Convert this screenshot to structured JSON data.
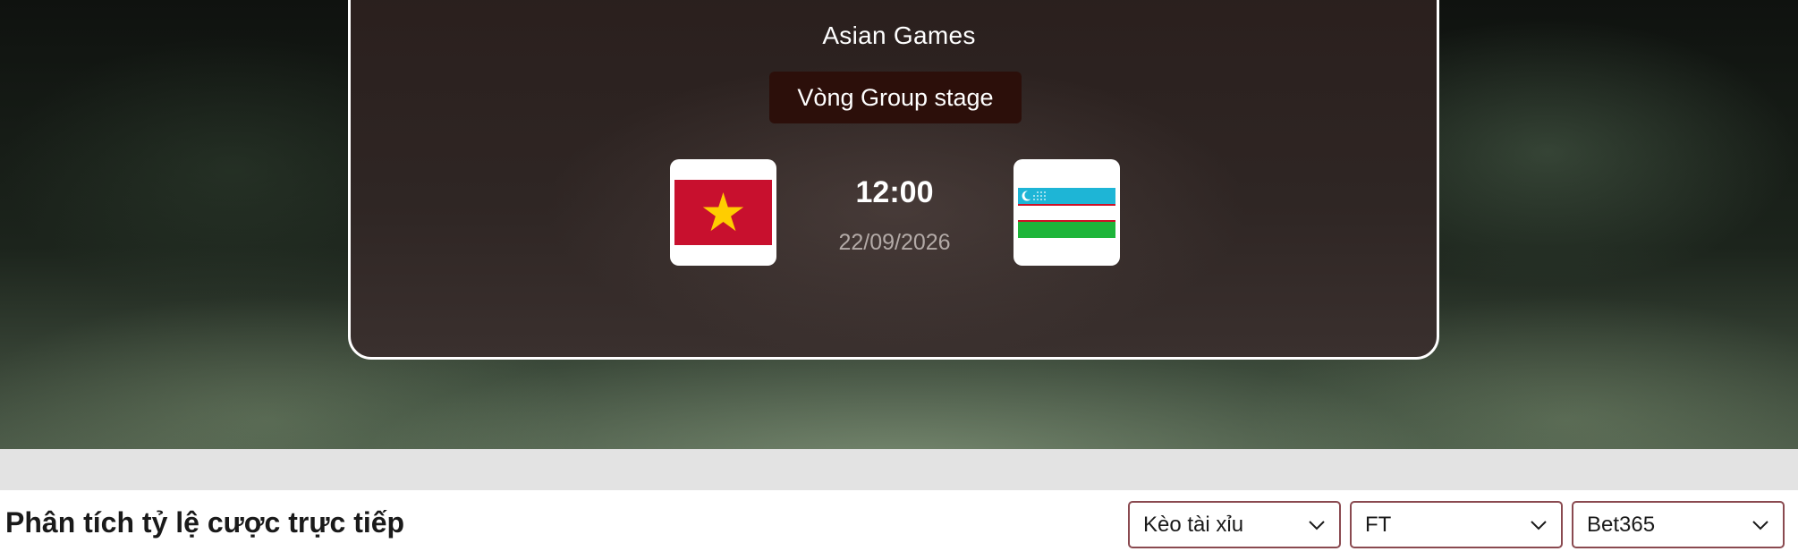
{
  "match": {
    "competition": "Asian Games",
    "round": "Vòng Group stage",
    "kickoff_time": "12:00",
    "kickoff_date": "22/09/2026",
    "home_flag_icon": "vietnam-flag-icon",
    "away_flag_icon": "uzbekistan-flag-icon"
  },
  "odds_section": {
    "title": "Phân tích tỷ lệ cược trực tiếp",
    "bet_type": "Kèo tài xỉu",
    "period": "FT",
    "bookmaker": "Bet365"
  },
  "colors": {
    "badge_bg": "#2c0f0a",
    "select_border": "#8a4a50",
    "vietnam_red": "#c8102e",
    "vietnam_star": "#ffcd00",
    "uzbek_blue": "#1eb5d6",
    "uzbek_green": "#1eb53a"
  }
}
